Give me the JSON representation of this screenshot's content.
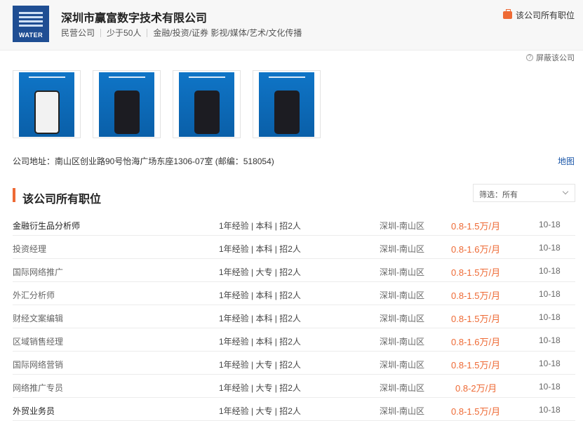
{
  "company": {
    "logo_text": "WATER",
    "name": "深圳市赢富数字技术有限公司",
    "meta": [
      "民营公司",
      "少于50人",
      "金融/投资/证券 影视/媒体/艺术/文化传播"
    ],
    "all_jobs_link": "该公司所有职位",
    "block_link": "屏蔽该公司"
  },
  "screenshots": [
    {
      "caption": "Explore Water Station"
    },
    {
      "caption": "Trade in confidence"
    },
    {
      "caption": "Manage risk even before placing an order"
    },
    {
      "caption": "Customize your watch list"
    }
  ],
  "address": {
    "text": "公司地址：南山区创业路90号怡海广场东座1306-07室 (邮编：518054)",
    "map_link": "地图"
  },
  "section": {
    "title": "该公司所有职位",
    "filter_text": "筛选：所有"
  },
  "jobs": [
    {
      "title": "金融衍生品分析师",
      "req": "1年经验 | 本科 | 招2人",
      "loc": "深圳-南山区",
      "salary": "0.8-1.5万/月",
      "date": "10-18"
    },
    {
      "title": "投资经理",
      "req": "1年经验 | 本科 | 招2人",
      "loc": "深圳-南山区",
      "salary": "0.8-1.6万/月",
      "date": "10-18"
    },
    {
      "title": "国际网络推广",
      "req": "1年经验 | 大专 | 招2人",
      "loc": "深圳-南山区",
      "salary": "0.8-1.5万/月",
      "date": "10-18"
    },
    {
      "title": "外汇分析师",
      "req": "1年经验 | 本科 | 招2人",
      "loc": "深圳-南山区",
      "salary": "0.8-1.5万/月",
      "date": "10-18"
    },
    {
      "title": "财经文案编辑",
      "req": "1年经验 | 本科 | 招2人",
      "loc": "深圳-南山区",
      "salary": "0.8-1.5万/月",
      "date": "10-18"
    },
    {
      "title": "区域销售经理",
      "req": "1年经验 | 本科 | 招2人",
      "loc": "深圳-南山区",
      "salary": "0.8-1.6万/月",
      "date": "10-18"
    },
    {
      "title": "国际网络营销",
      "req": "1年经验 | 大专 | 招2人",
      "loc": "深圳-南山区",
      "salary": "0.8-1.5万/月",
      "date": "10-18"
    },
    {
      "title": "网络推广专员",
      "req": "1年经验 | 大专 | 招2人",
      "loc": "深圳-南山区",
      "salary": "0.8-2万/月",
      "date": "10-18"
    },
    {
      "title": "外贸业务员",
      "req": "1年经验 | 大专 | 招2人",
      "loc": "深圳-南山区",
      "salary": "0.8-1.5万/月",
      "date": "10-18"
    }
  ],
  "colors": {
    "accent": "#ee6a35",
    "link": "#1a56a8",
    "logo_bg": "#1f4e93"
  }
}
